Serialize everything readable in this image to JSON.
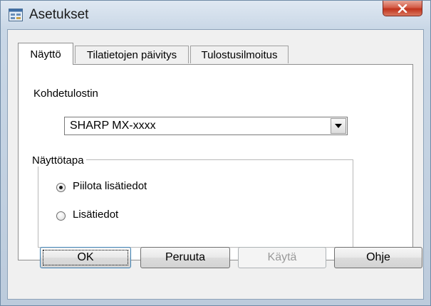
{
  "window": {
    "title": "Asetukset",
    "icon": "settings-app-icon",
    "close_icon": "close-x-icon"
  },
  "tabs": [
    {
      "label": "Näyttö",
      "active": true
    },
    {
      "label": "Tilatietojen päivitys",
      "active": false
    },
    {
      "label": "Tulostusilmoitus",
      "active": false
    }
  ],
  "panel": {
    "target_printer_label": "Kohdetulostin",
    "target_printer_value": "SHARP MX-xxxx",
    "display_mode_legend": "Näyttötapa",
    "radios": [
      {
        "label": "Piilota lisätiedot",
        "checked": true
      },
      {
        "label": "Lisätiedot",
        "checked": false
      }
    ]
  },
  "buttons": {
    "ok": "OK",
    "cancel": "Peruuta",
    "apply": "Käytä",
    "help": "Ohje"
  },
  "colors": {
    "close_button": "#c9402a",
    "default_button_border": "#3c7fb1"
  }
}
